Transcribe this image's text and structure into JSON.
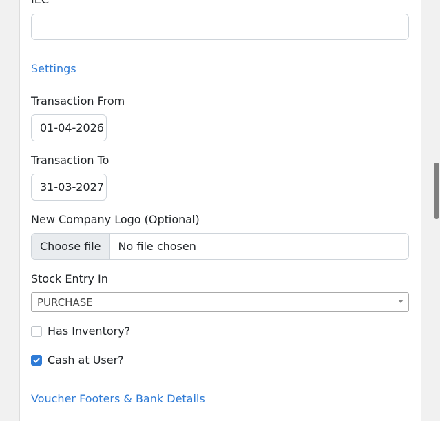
{
  "fields": {
    "iec_label": "IEC",
    "iec_value": "",
    "transaction_from_label": "Transaction From",
    "transaction_from_value": "01-04-2026",
    "transaction_to_label": "Transaction To",
    "transaction_to_value": "31-03-2027",
    "logo_label": "New Company Logo (Optional)",
    "logo_button": "Choose file",
    "logo_status": "No file chosen",
    "stock_entry_label": "Stock Entry In",
    "stock_entry_value": "PURCHASE",
    "has_inventory_label": "Has Inventory?",
    "has_inventory_checked": false,
    "cash_at_user_label": "Cash at User?",
    "cash_at_user_checked": true
  },
  "sections": {
    "settings": "Settings",
    "voucher_footers": "Voucher Footers & Bank Details"
  },
  "colors": {
    "accent": "#2f7bd6",
    "border": "#ced4da"
  }
}
